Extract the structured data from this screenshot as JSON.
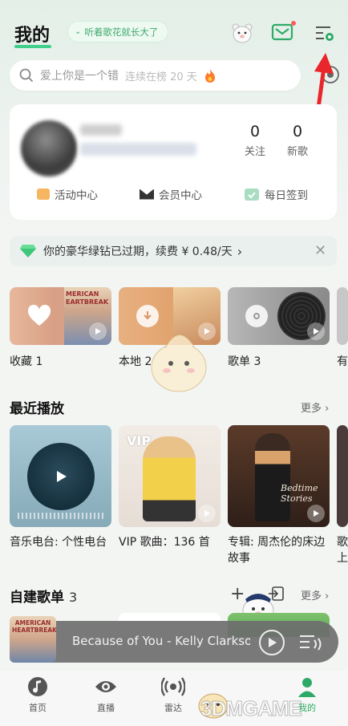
{
  "header": {
    "title": "我的",
    "tag": "听着歌花就长大了"
  },
  "search": {
    "placeholder": "爱上你是一个错",
    "trend": "连续在榜 20 天"
  },
  "profile": {
    "stats": [
      {
        "value": "0",
        "label": "关注"
      },
      {
        "value": "0",
        "label": "新歌"
      }
    ],
    "links": [
      "活动中心",
      "会员中心",
      "每日签到"
    ]
  },
  "vip": {
    "text": "你的豪华绿钻已过期，续费 ¥ 0.48/天"
  },
  "tiles": [
    {
      "label": "收藏 1",
      "art_text": "MERICAN EARTBREAK"
    },
    {
      "label": "本地 2"
    },
    {
      "label": "歌单 3"
    },
    {
      "label": "有"
    }
  ],
  "recent": {
    "title": "最近播放",
    "more": "更多",
    "cards": [
      {
        "label": "音乐电台: 个性电台"
      },
      {
        "label": "VIP 歌曲：136 首",
        "badge": "VIP"
      },
      {
        "label": "专辑: 周杰伦的床边故事",
        "art_text": "Bedtime Stories"
      },
      {
        "label": "歌上"
      }
    ]
  },
  "playlists": {
    "title": "自建歌单",
    "count": "3",
    "more": "更多"
  },
  "now_playing": {
    "title": "Because of You - Kelly Clarkson",
    "art_text": "AMERICAN HEARTBREAK"
  },
  "tabs": [
    {
      "label": "首页"
    },
    {
      "label": "直播"
    },
    {
      "label": "雷达"
    },
    {
      "label": "我的"
    }
  ],
  "watermark": "3DMGAME",
  "colors": {
    "accent": "#3fce8c",
    "arrow": "#e8262b"
  }
}
